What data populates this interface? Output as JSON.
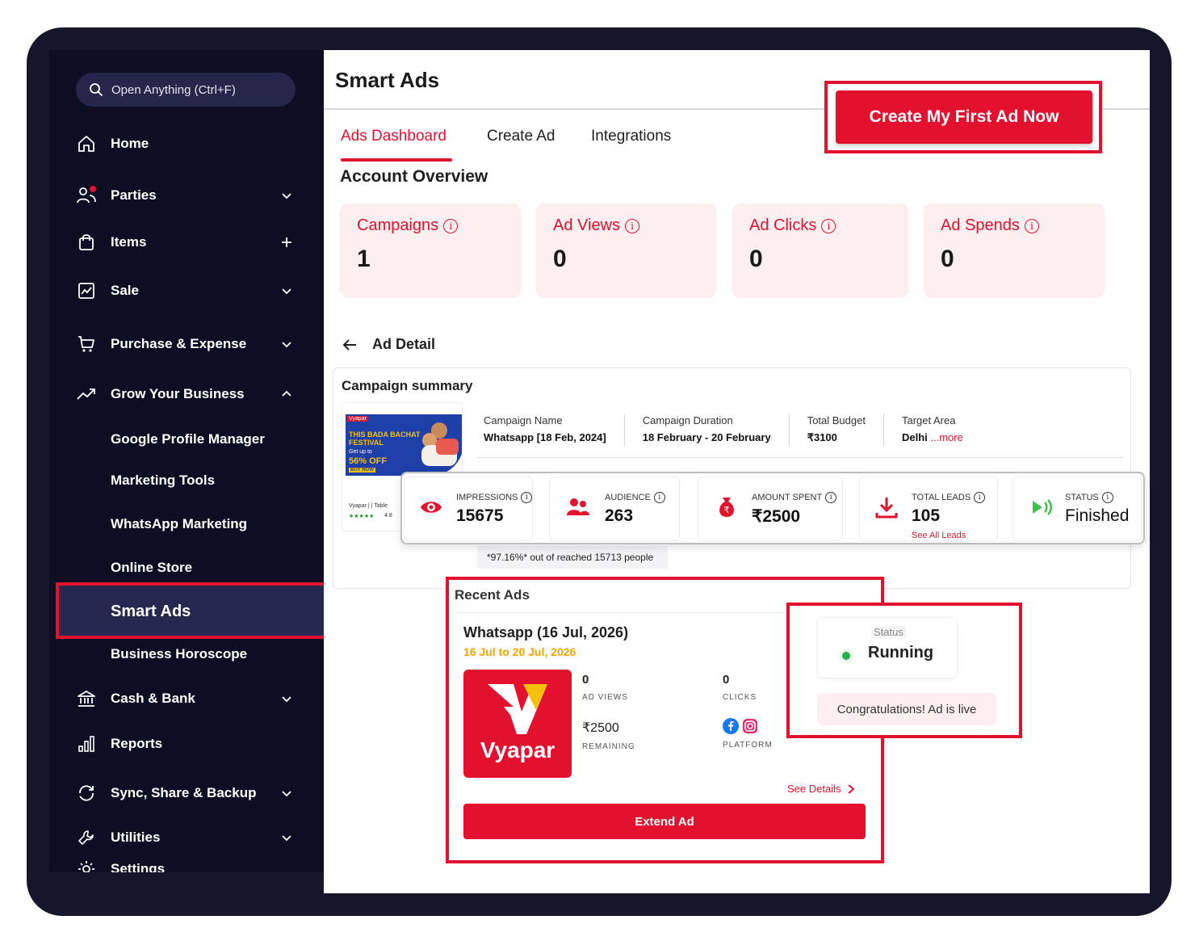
{
  "sidebar": {
    "search_placeholder": "Open Anything (Ctrl+F)",
    "items": [
      {
        "label": "Home"
      },
      {
        "label": "Parties"
      },
      {
        "label": "Items"
      },
      {
        "label": "Sale"
      },
      {
        "label": "Purchase & Expense"
      },
      {
        "label": "Grow Your Business"
      },
      {
        "label": "Cash & Bank"
      },
      {
        "label": "Reports"
      },
      {
        "label": "Sync, Share & Backup"
      },
      {
        "label": "Utilities"
      },
      {
        "label": "Settings"
      }
    ],
    "grow_sub": [
      {
        "label": "Google Profile Manager"
      },
      {
        "label": "Marketing Tools"
      },
      {
        "label": "WhatsApp Marketing"
      },
      {
        "label": "Online Store"
      },
      {
        "label": "Smart Ads"
      },
      {
        "label": "Business Horoscope"
      }
    ]
  },
  "main": {
    "title": "Smart Ads",
    "cta_label": "Create My First Ad Now",
    "tabs": [
      {
        "label": "Ads Dashboard"
      },
      {
        "label": "Create Ad"
      },
      {
        "label": "Integrations"
      }
    ],
    "account_overview_title": "Account Overview",
    "stats": [
      {
        "label": "Campaigns",
        "value": "1"
      },
      {
        "label": "Ad Views",
        "value": "0"
      },
      {
        "label": "Ad Clicks",
        "value": "0"
      },
      {
        "label": "Ad Spends",
        "value": "0"
      }
    ],
    "ad_detail_label": "Ad Detail",
    "campaign_summary": {
      "title": "Campaign summary",
      "banner": {
        "brand": "Vyapar",
        "headline": "THIS BADA BACHAT FESTIVAL",
        "sub": "Get up to",
        "offer": "56% OFF",
        "button": "BUY NOW",
        "footer": "Vyapar | | Table",
        "rating": "4.8"
      },
      "fields": [
        {
          "key": "Campaign Name",
          "value": "Whatsapp [18 Feb, 2024]"
        },
        {
          "key": "Campaign Duration",
          "value": "18 February - 20 February"
        },
        {
          "key": "Total Budget",
          "value": "₹3100"
        },
        {
          "key": "Target Area",
          "value": "Delhi",
          "more": "...more"
        }
      ]
    },
    "metrics": [
      {
        "label": "IMPRESSIONS",
        "value": "15675"
      },
      {
        "label": "AUDIENCE",
        "value": "263"
      },
      {
        "label": "AMOUNT SPENT",
        "value": "₹2500"
      },
      {
        "label": "TOTAL LEADS",
        "value": "105",
        "link": "See All Leads"
      },
      {
        "label": "STATUS",
        "value": "Finished"
      }
    ],
    "reach_note": "*97.16%* out of reached 15713 people",
    "recent_ads": {
      "title": "Recent Ads",
      "ad_title": "Whatsapp (16 Jul, 2026)",
      "ad_dates": "16 Jul to 20 Jul, 2026",
      "logo_text": "Vyapar",
      "ad_views_value": "0",
      "ad_views_label": "AD VIEWS",
      "clicks_value": "0",
      "clicks_label": "CLICKS",
      "remaining_value": "₹2500",
      "remaining_label": "REMAINING",
      "platform_label": "PLATFORM",
      "see_details": "See Details",
      "extend_label": "Extend Ad"
    },
    "status_panel": {
      "status_label": "Status",
      "status_value": "Running",
      "message": "Congratulations! Ad is live"
    }
  },
  "colors": {
    "accent": "#e3112d",
    "sidebar_bg": "#0d0e24",
    "stat_card_bg": "#fdeef0",
    "date_orange": "#f5a300",
    "running_green": "#22b14c"
  }
}
